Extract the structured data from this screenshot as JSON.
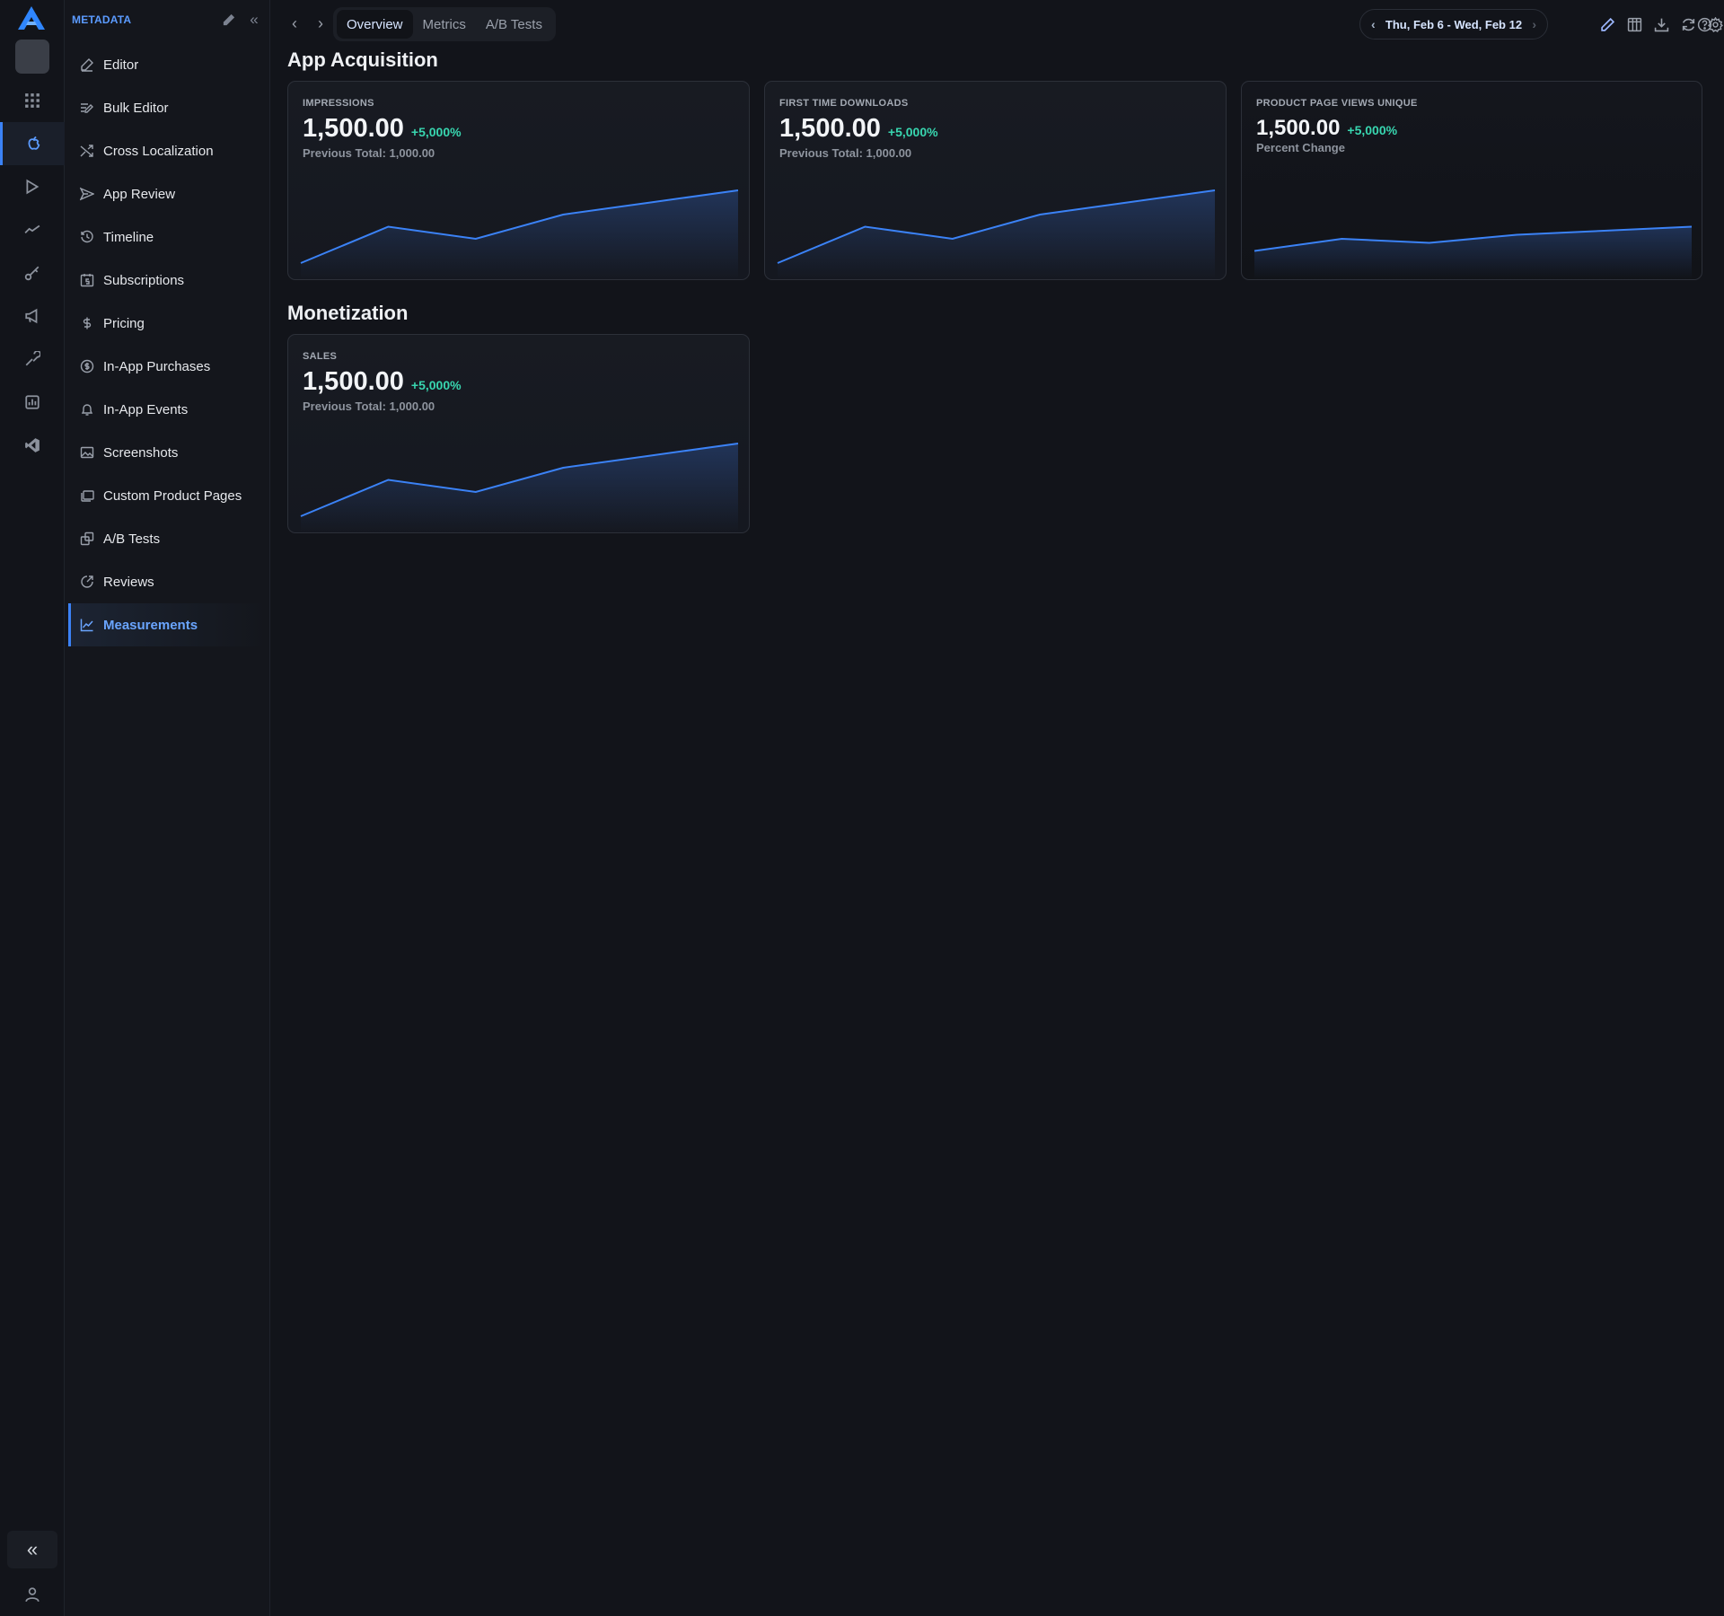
{
  "rail": {
    "items": [
      "grid-icon",
      "apple-icon",
      "play-icon",
      "trend-icon",
      "key-icon",
      "megaphone-icon",
      "tools-icon",
      "report-icon",
      "vscode-icon"
    ],
    "active_index": 1,
    "collapse_label": "«"
  },
  "sidebar": {
    "title": "METADATA",
    "items": [
      {
        "label": "Editor",
        "icon": "edit-icon"
      },
      {
        "label": "Bulk Editor",
        "icon": "bulk-edit-icon"
      },
      {
        "label": "Cross Localization",
        "icon": "shuffle-icon"
      },
      {
        "label": "App Review",
        "icon": "send-icon"
      },
      {
        "label": "Timeline",
        "icon": "history-icon"
      },
      {
        "label": "Subscriptions",
        "icon": "calendar-dollar-icon"
      },
      {
        "label": "Pricing",
        "icon": "dollar-icon"
      },
      {
        "label": "In-App Purchases",
        "icon": "coin-icon"
      },
      {
        "label": "In-App Events",
        "icon": "bell-icon"
      },
      {
        "label": "Screenshots",
        "icon": "image-icon"
      },
      {
        "label": "Custom Product Pages",
        "icon": "pages-icon"
      },
      {
        "label": "A/B Tests",
        "icon": "ab-icon"
      },
      {
        "label": "Reviews",
        "icon": "review-icon"
      },
      {
        "label": "Measurements",
        "icon": "chart-line-icon"
      }
    ],
    "active_index": 13
  },
  "topbar": {
    "tabs": [
      "Overview",
      "Metrics",
      "A/B Tests"
    ],
    "active_tab": 0,
    "date_range": "Thu, Feb 6 - Wed, Feb 12"
  },
  "sections": {
    "acquisition_title": "App Acquisition",
    "monetization_title": "Monetization"
  },
  "cards": {
    "impressions": {
      "label": "IMPRESSIONS",
      "value": "1,500.00",
      "delta": "+5,000%",
      "sub": "Previous Total: 1,000.00"
    },
    "downloads": {
      "label": "FIRST TIME DOWNLOADS",
      "value": "1,500.00",
      "delta": "+5,000%",
      "sub": "Previous Total: 1,000.00"
    },
    "page_views": {
      "label": "PRODUCT PAGE VIEWS UNIQUE",
      "value": "1,500.00",
      "delta": "+5,000%",
      "sub": "Percent Change"
    },
    "sales": {
      "label": "SALES",
      "value": "1,500.00",
      "delta": "+5,000%",
      "sub": "Previous Total: 1,000.00"
    }
  },
  "colors": {
    "accent": "#3b82f6",
    "positive": "#38d6b0",
    "background": "#12141a"
  },
  "chart_data": [
    {
      "type": "area",
      "values": [
        0,
        0.45,
        0.3,
        0.6,
        0.75,
        0.9
      ],
      "ylim": [
        0,
        1
      ]
    },
    {
      "type": "area",
      "values": [
        0,
        0.45,
        0.3,
        0.6,
        0.75,
        0.9
      ],
      "ylim": [
        0,
        1
      ]
    },
    {
      "type": "area",
      "values": [
        0.15,
        0.3,
        0.25,
        0.35,
        0.4,
        0.45
      ],
      "ylim": [
        0,
        1
      ]
    },
    {
      "type": "area",
      "values": [
        0,
        0.45,
        0.3,
        0.6,
        0.75,
        0.9
      ],
      "ylim": [
        0,
        1
      ]
    }
  ]
}
